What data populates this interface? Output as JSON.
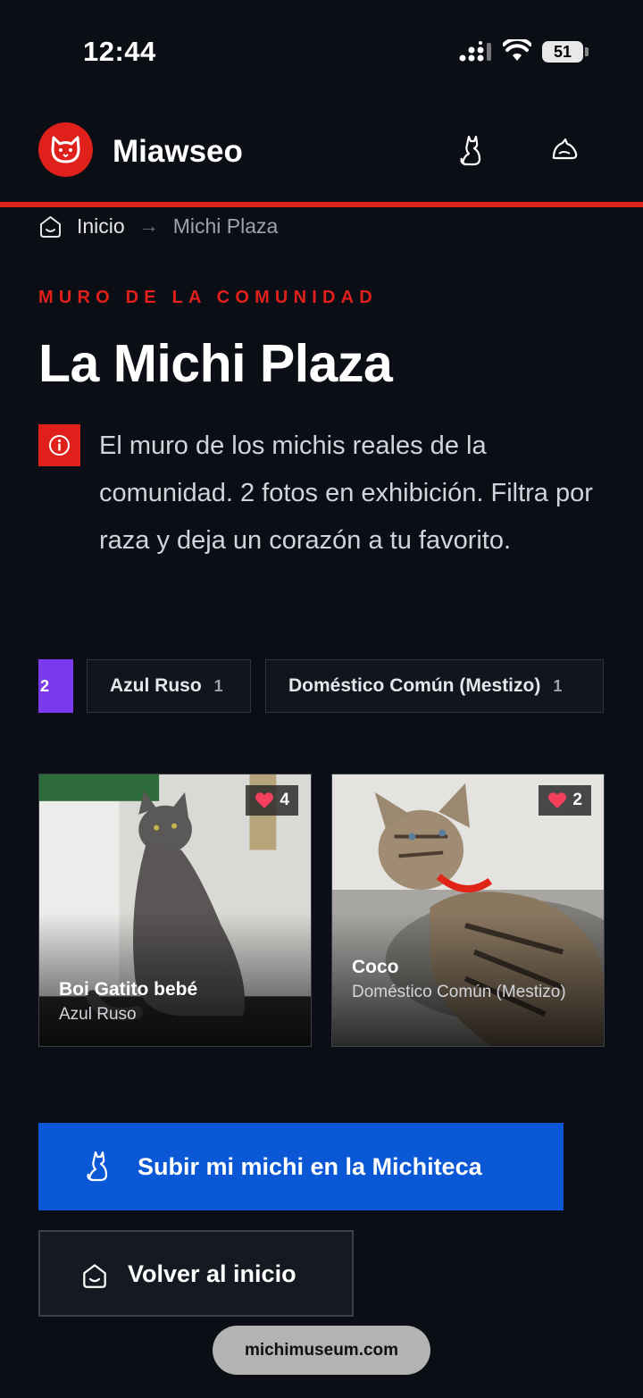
{
  "status_bar": {
    "time": "12:44",
    "battery": "51"
  },
  "header": {
    "brand": "Miawseo"
  },
  "breadcrumb": {
    "home": "Inicio",
    "current": "Michi Plaza"
  },
  "page": {
    "eyebrow": "MURO DE LA COMUNIDAD",
    "title": "La Michi Plaza",
    "description": "El muro de los michis reales de la comunidad. 2 fotos en exhibición. Filtra por raza y deja un corazón a tu favorito."
  },
  "filters": {
    "active_label": "2",
    "chips": [
      {
        "label": "Azul Ruso",
        "count": "1"
      },
      {
        "label": "Doméstico Común (Mestizo)",
        "count": "1"
      }
    ]
  },
  "cats": [
    {
      "name": "Boi Gatito bebé",
      "breed": "Azul Ruso",
      "likes": "4"
    },
    {
      "name": "Coco",
      "breed": "Doméstico Común (Mestizo)",
      "likes": "2"
    }
  ],
  "actions": {
    "upload_label": "Subir mi michi en la Michiteca",
    "back_label": "Volver al inicio"
  },
  "browser": {
    "url": "michimuseum.com"
  },
  "colors": {
    "accent": "#e0201b",
    "primary": "#0a58d6",
    "chip_active": "#7c3aed",
    "background": "#0b0e14"
  }
}
